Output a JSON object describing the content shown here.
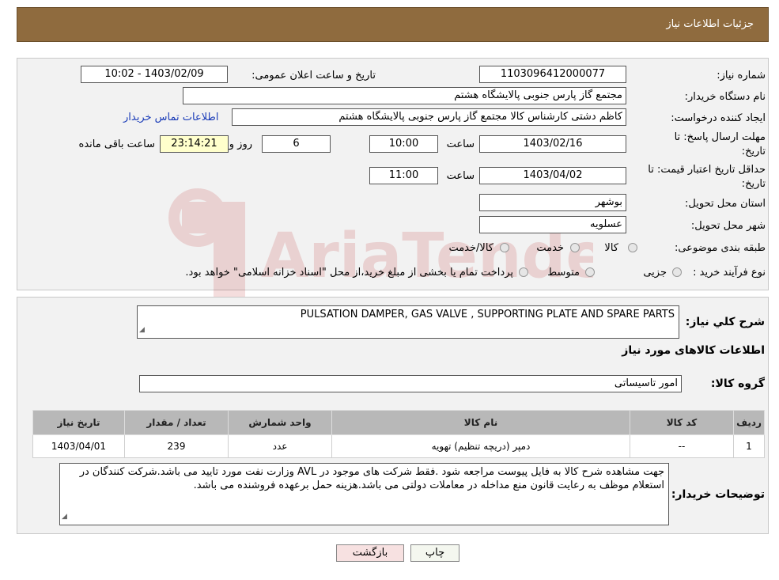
{
  "title": "جزئیات اطلاعات نیاز",
  "header": {
    "need_number_label": "شماره نیاز:",
    "need_number": "1103096412000077",
    "announce_label": "تاریخ و ساعت اعلان عمومی:",
    "announce_value": "1403/02/09 - 10:02",
    "buyer_org_label": "نام دستگاه خریدار:",
    "buyer_org": "مجتمع گاز پارس جنوبی  پالایشگاه هشتم",
    "creator_label": "ایجاد کننده درخواست:",
    "creator": "کاظم دشتی کارشناس کالا مجتمع گاز پارس جنوبی  پالایشگاه هشتم",
    "contact_link": "اطلاعات تماس خریدار",
    "deadline_label_line1": "مهلت ارسال پاسخ: تا",
    "deadline_label_line2": "تاریخ:",
    "deadline_date": "1403/02/16",
    "time_label": "ساعت",
    "deadline_time": "10:00",
    "days_count": "6",
    "days_label": "روز و",
    "remaining_time": "23:14:21",
    "remaining_label": "ساعت باقی مانده",
    "validity_label_line1": "حداقل تاریخ اعتبار قیمت: تا",
    "validity_label_line2": "تاریخ:",
    "validity_date": "1403/04/02",
    "validity_time": "11:00",
    "province_label": "استان محل تحویل:",
    "province": "بوشهر",
    "city_label": "شهر محل تحویل:",
    "city": "عسلویه",
    "category_label": "طبقه بندی موضوعی:",
    "category_options": [
      "کالا",
      "خدمت",
      "کالا/خدمت"
    ],
    "process_label": "نوع فرآیند خرید :",
    "process_options": [
      "جزیی",
      "متوسط"
    ],
    "process_note": "پرداخت تمام یا بخشی از مبلغ خرید،از محل \"اسناد خزانه اسلامی\" خواهد بود."
  },
  "section2": {
    "desc_label": "شرح کلي نياز:",
    "desc_value": "PULSATION DAMPER,  GAS VALVE , SUPPORTING PLATE AND SPARE PARTS",
    "goods_info_label": "اطلاعات کالاهای مورد نیاز",
    "group_label": "گروه کالا:",
    "group_value": "امور تاسیساتی",
    "table": {
      "headers": [
        "ردیف",
        "کد کالا",
        "نام کالا",
        "واحد شمارش",
        "تعداد / مقدار",
        "تاریخ نیاز"
      ],
      "rows": [
        [
          "1",
          "--",
          "دمپر (دریچه تنظیم) تهویه",
          "عدد",
          "239",
          "1403/04/01"
        ]
      ]
    },
    "notes_label": "توضیحات خریدار:",
    "notes_value": "جهت مشاهده شرح کالا به فایل پیوست مراجعه شود .فقط شرکت های موجود در AVL وزارت نفت مورد تایید می باشد.شرکت کنندگان در استعلام موظف به رعایت قانون منع مداخله در معاملات دولتی می باشد.هزینه حمل برعهده فروشنده می باشد."
  },
  "buttons": {
    "print": "چاپ",
    "back": "بازگشت"
  },
  "watermark": {
    "text": "AriaTender.neT",
    "color": "#b00000"
  }
}
